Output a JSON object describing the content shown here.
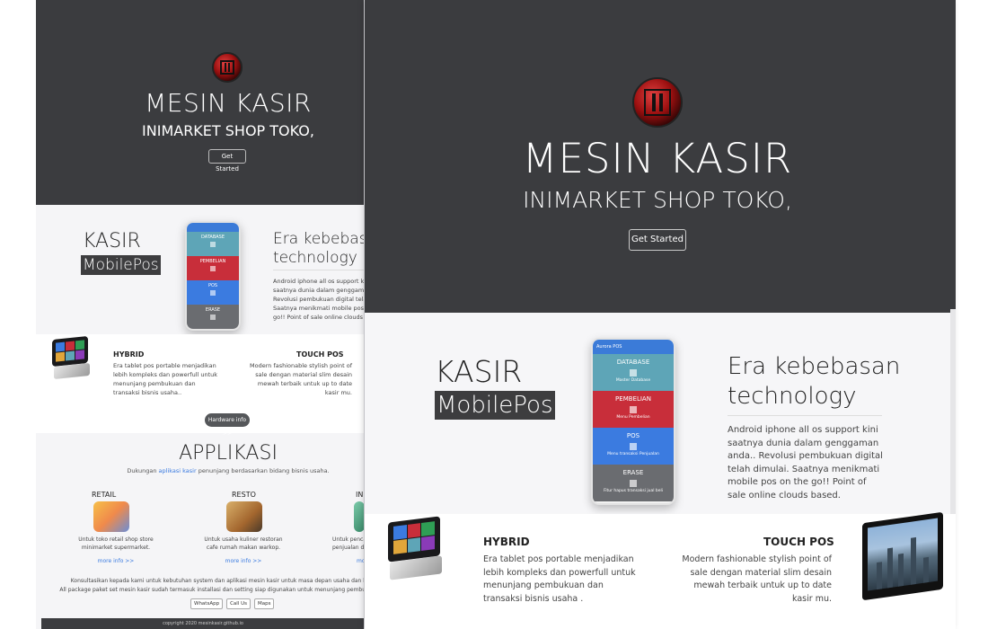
{
  "small": {
    "hero": {
      "title": "MESIN KASIR",
      "subtitle": "INIMARKET SHOP TOKO,",
      "button": "Get Started"
    },
    "kasir": "KASIR",
    "mobilepos": "MobilePos",
    "phone": {
      "tiles": [
        "DATABASE",
        "PEMBELIAN",
        "POS",
        "ERASE"
      ]
    },
    "era": {
      "line1": "Era kebebasan",
      "line2": "technology",
      "desc": [
        "Android iphone all os support kini",
        "saatnya dunia dalam genggaman and",
        "Revolusi pembukuan digital telah dimul",
        "Saatnya menikmati mobile pos on the",
        "go!! Point of sale online clouds based."
      ]
    },
    "hybrid": {
      "title": "HYBRID",
      "desc": "Era tablet pos portable menjadikan lebih kompleks dan powerfull untuk menunjang pembukuan dan transaksi bisnis usaha.."
    },
    "touchpos": {
      "title": "TOUCH POS",
      "desc": "Modern fashionable stylish point of sale dengan material slim desain mewah terbaik untuk up to date kasir mu."
    },
    "hardware_btn": "Hardware info >>",
    "app_title": "APPLIKASI",
    "app_sub_pre": "Dukungan ",
    "app_sub_link": "aplikasi kasir",
    "app_sub_post": " penunjang berdasarkan bidang bisnis usaha.",
    "categories": [
      {
        "title": "RETAIL",
        "desc": "Untuk toko retail shop store minimarket supermarket.",
        "more": "more info >>"
      },
      {
        "title": "RESTO",
        "desc": "Untuk usaha kuliner restoran cafe rumah makan warkop.",
        "more": "more info >>"
      },
      {
        "title": "IN",
        "desc": "Untuk penca penjualan d",
        "more": "mo"
      }
    ],
    "footer": {
      "line1": "Konsultasikan kepada kami untuk kebutuhan system dan aplikasi mesin kasir untuk masa depan usaha dan bisnis m",
      "line2": "All package paket set mesin kasir sudah termasuk installasi dan setting siap digunakan untuk menunjang pembukuan usaha",
      "buttons": [
        "WhatsApp",
        "Call Us",
        "Maps"
      ],
      "copyright": "copyright 2020 mesinkasir.github.io"
    }
  },
  "large": {
    "hero": {
      "title": "MESIN KASIR",
      "subtitle": "INIMARKET SHOP TOKO,",
      "button": "Get Started"
    },
    "kasir": "KASIR",
    "mobilepos": "MobilePos",
    "phone": {
      "bar": "Aurora POS",
      "tiles": [
        {
          "label": "DATABASE",
          "small": "Master Database"
        },
        {
          "label": "PEMBELIAN",
          "small": "Menu Pembelian"
        },
        {
          "label": "POS",
          "small": "Menu transaksi Penjualan"
        },
        {
          "label": "ERASE",
          "small": "Fitur hapus transaksi jual beli"
        }
      ]
    },
    "era": {
      "line1": "Era kebebasan",
      "line2": "technology",
      "desc": "Android iphone all os support kini saatnya dunia dalam genggaman anda.. Revolusi pembukuan digital telah dimulai. Saatnya menikmati mobile pos on the go!! Point of sale online clouds based."
    },
    "hybrid": {
      "title": "HYBRID",
      "desc": "Era tablet pos portable menjadikan lebih kompleks dan powerfull untuk menunjang pembukuan dan transaksi bisnis usaha ."
    },
    "touchpos": {
      "title": "TOUCH POS",
      "desc": "Modern fashionable stylish point of sale dengan material slim desain mewah terbaik untuk up to date kasir mu."
    }
  },
  "colors": {
    "hero_bg": "#3b3c3f",
    "database": "#5ea5b7",
    "pembelian": "#c82e3a",
    "pos": "#3b7be0",
    "erase": "#6a6c70"
  },
  "icons": [
    "logo-emblem",
    "tablet-pos-image",
    "touch-monitor-image",
    "retail-illustration",
    "resto-illustration"
  ]
}
